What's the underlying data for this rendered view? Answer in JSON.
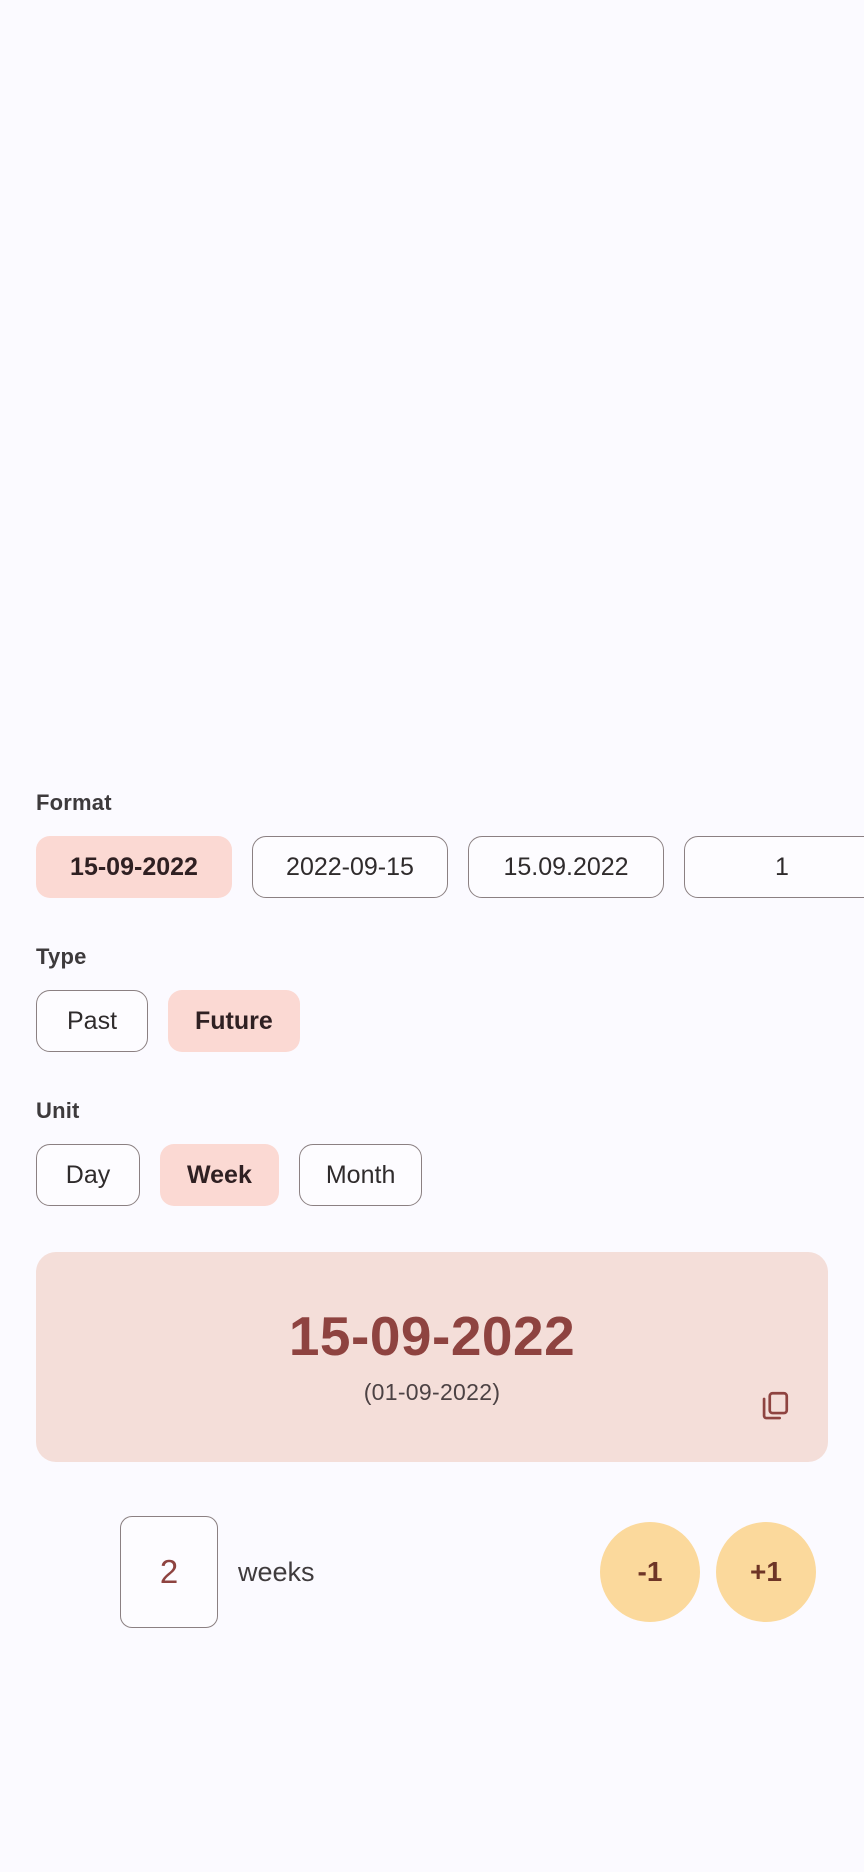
{
  "app": {
    "background_color": "#fbfaff",
    "accent_pink": "#fbd9d3",
    "accent_card": "#f4ded9",
    "accent_dark_red": "#8e4340",
    "accent_orange": "#fbd99c"
  },
  "format_section": {
    "label": "Format",
    "options": [
      {
        "label": "15-09-2022",
        "selected": true
      },
      {
        "label": "2022-09-15",
        "selected": false
      },
      {
        "label": "15.09.2022",
        "selected": false
      },
      {
        "label": "1",
        "selected": false
      }
    ]
  },
  "type_section": {
    "label": "Type",
    "options": [
      {
        "label": "Past",
        "selected": false
      },
      {
        "label": "Future",
        "selected": true
      }
    ]
  },
  "unit_section": {
    "label": "Unit",
    "options": [
      {
        "label": "Day",
        "selected": false
      },
      {
        "label": "Week",
        "selected": true
      },
      {
        "label": "Month",
        "selected": false
      }
    ]
  },
  "result": {
    "main_date": "15-09-2022",
    "base_date": "(01-09-2022)",
    "copy_icon": "copy-icon"
  },
  "stepper": {
    "amount": "2",
    "unit_word": "weeks",
    "decrement_label": "-1",
    "increment_label": "+1"
  }
}
